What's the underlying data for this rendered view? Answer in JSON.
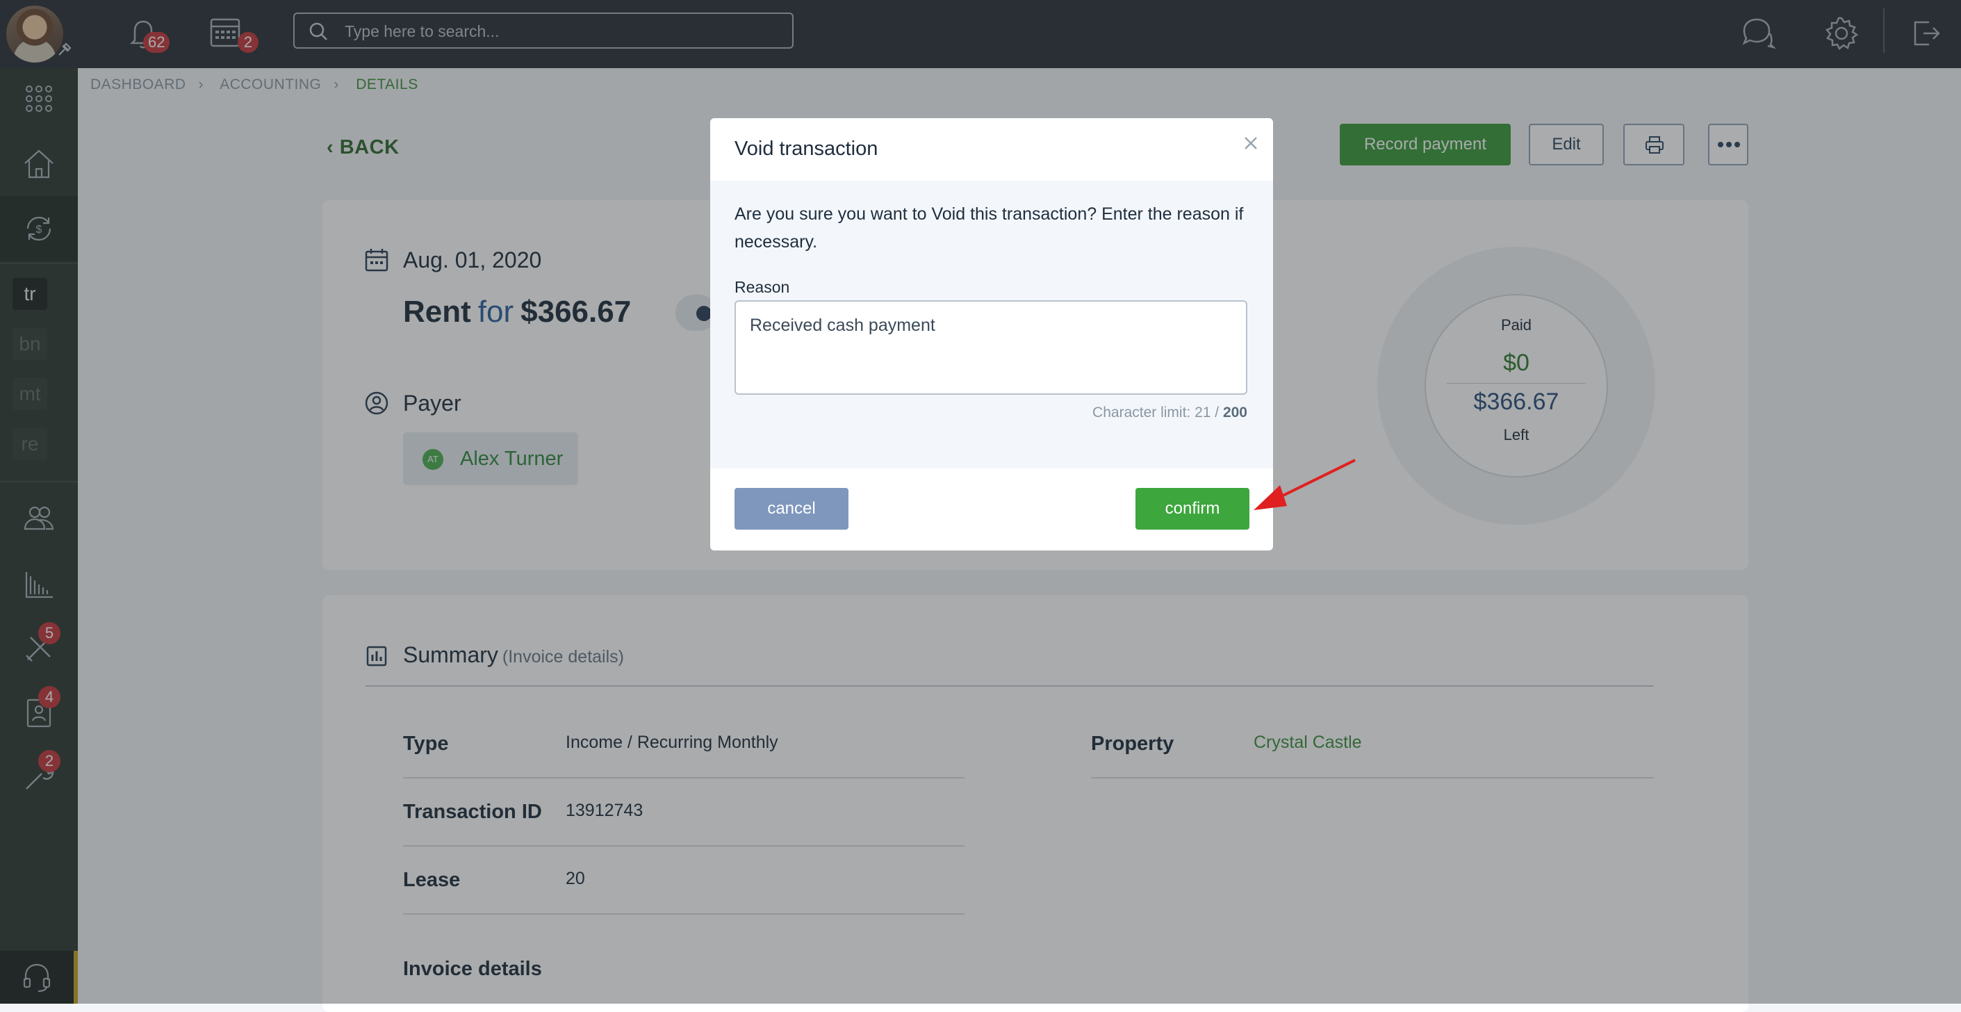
{
  "topbar": {
    "notifications_count": "62",
    "calendar_count": "2",
    "search_placeholder": "Type here to search..."
  },
  "sidebar": {
    "letters": [
      "tr",
      "bn",
      "mt",
      "re"
    ],
    "tools_badge": "5",
    "contacts_badge": "4",
    "maintenance_badge": "2"
  },
  "breadcrumb": {
    "items": [
      "DASHBOARD",
      "ACCOUNTING",
      "DETAILS"
    ]
  },
  "page": {
    "back_label": "BACK",
    "record_payment_label": "Record payment",
    "edit_label": "Edit",
    "date": "Aug. 01, 2020",
    "category": "Rent",
    "for_word": "for",
    "amount": "$366.67",
    "payer_label": "Payer",
    "payer_initials": "AT",
    "payer_name": "Alex Turner",
    "paid_label": "Paid",
    "paid_value": "$0",
    "left_value": "$366.67",
    "left_label": "Left"
  },
  "summary": {
    "title": "Summary",
    "subtitle": "(Invoice details)",
    "type_label": "Type",
    "type_value": "Income / Recurring Monthly",
    "transaction_id_label": "Transaction ID",
    "transaction_id_value": "13912743",
    "lease_label": "Lease",
    "lease_value": "20",
    "invoice_details_label": "Invoice details",
    "property_label": "Property",
    "property_value": "Crystal Castle"
  },
  "modal": {
    "title": "Void transaction",
    "message": "Are you sure you want to Void this transaction? Enter the reason if necessary.",
    "reason_label": "Reason",
    "reason_value": "Received cash payment",
    "char_limit_prefix": "Character limit: 21 / ",
    "char_limit_max": "200",
    "cancel_label": "cancel",
    "confirm_label": "confirm"
  },
  "colors": {
    "topbar": "#2b3137",
    "sidebar": "#2e3a33",
    "accent_green": "#3a9a3a",
    "cancel_blue": "#7f97bd",
    "badge_red": "#c5383d",
    "annotation_arrow": "#e02020"
  }
}
